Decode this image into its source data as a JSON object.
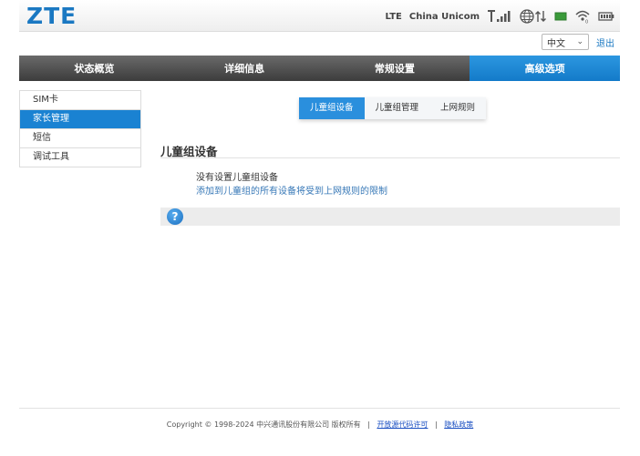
{
  "header": {
    "logo": "ZTE",
    "network_type": "LTE",
    "operator": "China Unicom",
    "icons": [
      "signal-icon",
      "globe-transfer-icon",
      "sim-icon",
      "wifi-icon",
      "battery-icon"
    ]
  },
  "language": {
    "selected": "中文",
    "logout_label": "退出"
  },
  "nav": {
    "items": [
      {
        "label": "状态概览"
      },
      {
        "label": "详细信息"
      },
      {
        "label": "常规设置"
      },
      {
        "label": "高级选项"
      }
    ],
    "active_index": 3
  },
  "sidebar": {
    "items": [
      {
        "label": "SIM卡"
      },
      {
        "label": "家长管理"
      },
      {
        "label": "短信"
      },
      {
        "label": "调试工具"
      }
    ],
    "active_index": 1
  },
  "subtabs": {
    "items": [
      {
        "label": "儿童组设备"
      },
      {
        "label": "儿童组管理"
      },
      {
        "label": "上网规则"
      }
    ],
    "active_index": 0
  },
  "content": {
    "title": "儿童组设备",
    "empty_message": "没有设置儿童组设备",
    "hint": "添加到儿童组的所有设备将受到上网规则的限制",
    "help_symbol": "?"
  },
  "footer": {
    "copyright": "Copyright © 1998-2024 中兴通讯股份有限公司 版权所有",
    "separator": "|",
    "open_source_link": "开放源代码许可",
    "privacy_link": "隐私政策"
  },
  "colors": {
    "brand": "#1a78c2",
    "nav_active": "#1a82d2",
    "nav_bg": "#4a4a4a",
    "link": "#3778b7"
  }
}
